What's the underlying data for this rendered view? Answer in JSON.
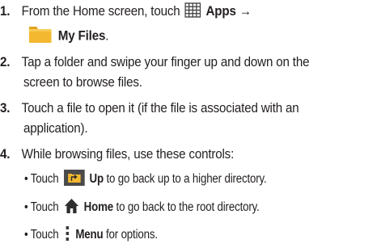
{
  "steps": [
    {
      "number": "1.",
      "touch_text": "From the Home screen, touch",
      "apps_label": "Apps",
      "arrow": "→",
      "myfiles_label": "My Files",
      "period": ".",
      "apps_icon": "apps-grid-icon",
      "folder_icon": "folder-icon"
    },
    {
      "number": "2.",
      "line1": "Tap a folder and swipe your finger up and down on the",
      "line2": "screen to browse files."
    },
    {
      "number": "3.",
      "line1": "Touch a file to open it (if the file is associated with an",
      "line2": "application)."
    },
    {
      "number": "4.",
      "line1": "While browsing files, use these controls:"
    }
  ],
  "controls": [
    {
      "bullet": "•",
      "touch": "Touch",
      "label": "Up",
      "text": "to go back up to a higher directory.",
      "icon": "folder-up-icon"
    },
    {
      "bullet": "•",
      "touch": "Touch",
      "label": "Home",
      "text": "to go back to the root directory.",
      "icon": "home-icon"
    },
    {
      "bullet": "•",
      "touch": "Touch",
      "label": "Menu",
      "text": "for options.",
      "icon": "menu-icon"
    }
  ],
  "colors": {
    "text": "#231f20",
    "folder": "#f3b830",
    "folder_up_bg": "#4a4a4a",
    "icon_dark": "#3a3a3a"
  }
}
